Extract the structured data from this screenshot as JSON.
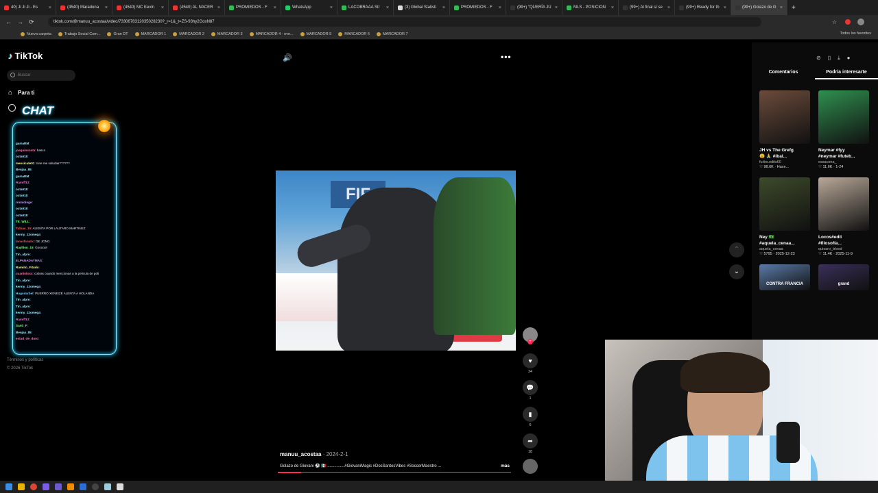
{
  "browser": {
    "tabs": [
      {
        "label": "40) Ji Ji Ji - Es",
        "color": "#e33"
      },
      {
        "label": "(4540) Maradona",
        "color": "#e33"
      },
      {
        "label": "(4540) MC Kevin",
        "color": "#e33"
      },
      {
        "label": "(4540) AL NACER",
        "color": "#e33"
      },
      {
        "label": "PROMIEDOS - F",
        "color": "#3b5"
      },
      {
        "label": "WhatsApp",
        "color": "#2c6"
      },
      {
        "label": "LACOBRAAA Str",
        "color": "#3b5"
      },
      {
        "label": "(3) Global Statisti",
        "color": "#ddd"
      },
      {
        "label": "PROMIEDOS - F",
        "color": "#3b5"
      },
      {
        "label": "(99+) \"QUERÍA JU",
        "color": "#333"
      },
      {
        "label": "MLS - POSICION",
        "color": "#3b5"
      },
      {
        "label": "(99+) Al final sí se",
        "color": "#333"
      },
      {
        "label": "(99+) Ready for th",
        "color": "#333"
      },
      {
        "label": "(99+) Golazo de G",
        "color": "#333"
      }
    ],
    "url": "tiktok.com/@manuu_acostaa/video/7330678312035028230?_r=1&_t=ZS-93hy2GoxN87",
    "bookmarks": [
      "Nueva carpeta",
      "Trabajo Social Com...",
      "Gran DT",
      "MARCADOR 1",
      "MARCADOR 2",
      "MARCADOR 3",
      "MARCADOR 4 - ove...",
      "MARCADOR 5",
      "MARCADOR 6",
      "MARCADOR 7"
    ],
    "all_bookmarks": "Todos los favoritos"
  },
  "tiktok": {
    "logo": "TikTok",
    "search_placeholder": "Buscar",
    "nav": {
      "for_you": "Para ti"
    },
    "footer": {
      "terms": "Términos y políticas",
      "copyright": "© 2026 TikTok"
    }
  },
  "overlay_chat": {
    "title": "CHAT",
    "messages": [
      {
        "user": "gamaRM",
        "text": ": ",
        "color": "#9ef"
      },
      {
        "user": "joaquinsosta",
        "text": ": basco",
        "color": "#f7a"
      },
      {
        "user": "octa918",
        "text": ": ",
        "color": "#9ef"
      },
      {
        "user": "messicule01",
        "text": ": nine me saludas??????",
        "color": "#ff8"
      },
      {
        "user": "Benjaa_85",
        "text": ": ",
        "color": "#9ef"
      },
      {
        "user": "gamaRM",
        "text": ": ",
        "color": "#9ef"
      },
      {
        "user": "Ramiff13",
        "text": ": ",
        "color": "#f6c"
      },
      {
        "user": "octa918",
        "text": ": ",
        "color": "#9ef"
      },
      {
        "user": "octa918",
        "text": ": ",
        "color": "#9ef"
      },
      {
        "user": "ronaldinge",
        "text": ": ",
        "color": "#c9f"
      },
      {
        "user": "octa918",
        "text": ": ",
        "color": "#9ef"
      },
      {
        "user": "octa918",
        "text": ": ",
        "color": "#9ef"
      },
      {
        "user": "TE_WILL",
        "text": ": ",
        "color": "#8f8"
      },
      {
        "user": "Tobias_16",
        "text": ": ALIENTA POR LAUTARO MARTINEZ",
        "color": "#f55"
      },
      {
        "user": "kenny_12omega",
        "text": ": ",
        "color": "#9ef"
      },
      {
        "user": "lanasfanatic",
        "text": ": DE JONG",
        "color": "#f55"
      },
      {
        "user": "Rayllion_15",
        "text": ": Goooool",
        "color": "#8f8"
      },
      {
        "user": "Tin_alpro",
        "text": ": ",
        "color": "#9ef"
      },
      {
        "user": "ELPANADAYMAS",
        "text": ": ",
        "color": "#c9f"
      },
      {
        "user": "Ramiito_Fitudo",
        "text": ": ",
        "color": "#ff8"
      },
      {
        "user": "cuantotoxx",
        "text": ": cobras cuando mencionas a la pelicula de poli",
        "color": "#f7a"
      },
      {
        "user": "Tin_alpro",
        "text": ": ",
        "color": "#9ef"
      },
      {
        "user": "kenny_12omega",
        "text": ": ",
        "color": "#9ef"
      },
      {
        "user": "Hugodarbel",
        "text": ": PUERRO XENEIZE ALENTA A HOLANDA",
        "color": "#6cf"
      },
      {
        "user": "Tin_alpro",
        "text": ": ",
        "color": "#9ef"
      },
      {
        "user": "Tin_alpro",
        "text": ": ",
        "color": "#9ef"
      },
      {
        "user": "kenny_12omega",
        "text": ": ",
        "color": "#9ef"
      },
      {
        "user": "Ramiff13",
        "text": ": ",
        "color": "#f6c"
      },
      {
        "user": "Santi_F",
        "text": ": ",
        "color": "#8f8"
      },
      {
        "user": "Benjaa_85",
        "text": ": ",
        "color": "#9ef"
      },
      {
        "user": "estad_de_duro",
        "text": ": ",
        "color": "#f7a"
      }
    ]
  },
  "video": {
    "author": "manuu_acostaa",
    "date": " · 2024-2-1",
    "caption": "Golazo de Giovani ⚽ 🇲🇽 ...............#GiovaniMagic #DosSantosVibes #SoccerMaestro ...",
    "more": "más",
    "likes": "34",
    "comments": "1",
    "saves": "6",
    "shares": "18",
    "progress": 0.1
  },
  "right_panel": {
    "tabs": [
      "Comentarios",
      "Podría interesarte"
    ],
    "active_tab": 1,
    "cards": [
      {
        "title": "JH vs The Grefg",
        "line2": "😩 🙏 #ibai...",
        "author": "furbo.edits60",
        "stats": "♡ 98.6K · Hace...",
        "bg": "#6b4b3b"
      },
      {
        "title": "Neymar #fyy",
        "line2": "#neymar #futeb...",
        "author": "essacena_",
        "stats": "♡ 11.6K · 1-24",
        "bg": "#2f8f4f"
      },
      {
        "title": "Ney 🇧🇷",
        "line2": "#aquela_cenaa...",
        "author": "aquela_cenaa",
        "stats": "♡ 5795 · 2025-12-23",
        "bg": "#3d4a2a"
      },
      {
        "title": "Locos#edit",
        "line2": "#filosofía...",
        "author": "quisaro_blood",
        "stats": "♡ 11.4K · 2025-11-9",
        "bg": "#b8a898"
      },
      {
        "title": "",
        "line2": "",
        "author": "",
        "stats": "",
        "bg": "#5a7aa8",
        "overlay": "CONTRA FRANCIA"
      },
      {
        "title": "",
        "line2": "",
        "author": "",
        "stats": "",
        "bg": "#3a2f5a",
        "overlay": "grand"
      }
    ]
  }
}
